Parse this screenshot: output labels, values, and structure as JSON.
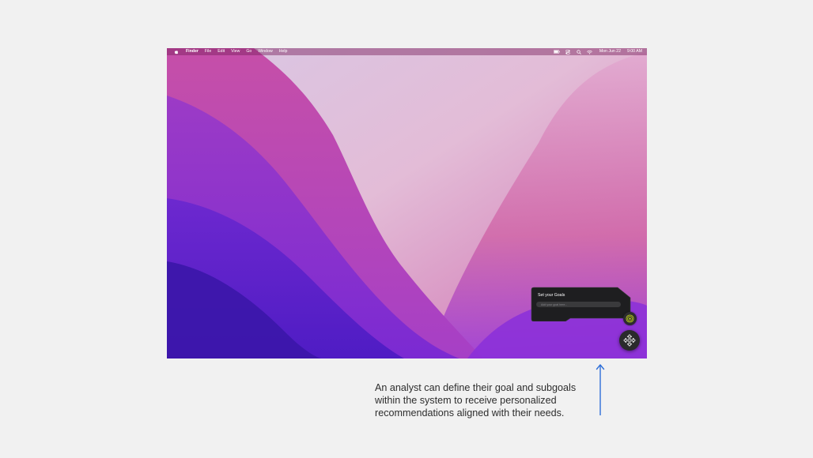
{
  "menubar": {
    "app_name": "Finder",
    "menus": [
      "File",
      "Edit",
      "View",
      "Go",
      "Window",
      "Help"
    ],
    "date": "Mon Jun 22",
    "time": "9:00 AM"
  },
  "goals_panel": {
    "title": "Set your Goals",
    "input_placeholder": "Add your goal here..."
  },
  "annotation": {
    "caption_lines": [
      "An analyst can define their goal and subgoals",
      "within the system to receive personalized",
      "recommendations aligned with their needs."
    ]
  },
  "colors": {
    "page_background": "#f1f1f1",
    "arrow": "#2f6fd8",
    "goal_icon_accent": "#b7c91c",
    "panel_background": "#1e1e20"
  }
}
